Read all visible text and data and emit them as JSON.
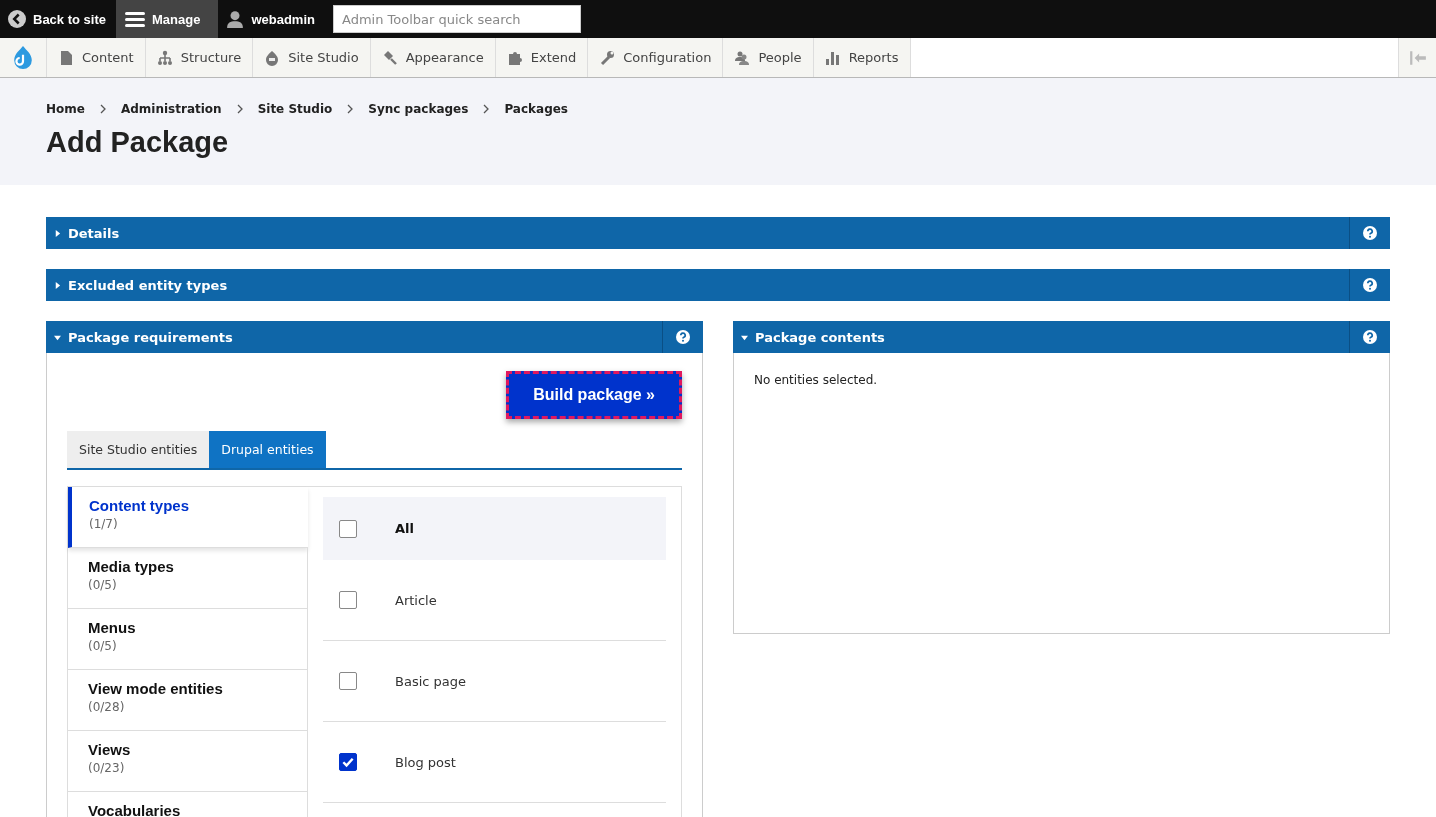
{
  "admin_bar": {
    "back": "Back to site",
    "manage": {
      "label": "Manage",
      "selected": true
    },
    "user": "webadmin",
    "search": {
      "placeholder": "Admin Toolbar quick search"
    }
  },
  "menu": [
    {
      "label": "Content"
    },
    {
      "label": "Structure"
    },
    {
      "label": "Site Studio"
    },
    {
      "label": "Appearance"
    },
    {
      "label": "Extend"
    },
    {
      "label": "Configuration"
    },
    {
      "label": "People"
    },
    {
      "label": "Reports"
    }
  ],
  "breadcrumb": [
    "Home",
    "Administration",
    "Site Studio",
    "Sync packages",
    "Packages"
  ],
  "title": "Add Package",
  "sections": [
    {
      "title": "Details",
      "expanded": false
    },
    {
      "title": "Excluded entity types",
      "expanded": false
    }
  ],
  "requirements": {
    "title": "Package requirements",
    "expanded": true,
    "build_button": "Build package »",
    "tabs": [
      {
        "label": "Site Studio entities",
        "selected": false
      },
      {
        "label": "Drupal entities",
        "selected": true
      }
    ],
    "categories": [
      {
        "label": "Content types",
        "count": "(1/7)",
        "selected": true
      },
      {
        "label": "Media types",
        "count": "(0/5)",
        "selected": false
      },
      {
        "label": "Menus",
        "count": "(0/5)",
        "selected": false
      },
      {
        "label": "View mode entities",
        "count": "(0/28)",
        "selected": false
      },
      {
        "label": "Views",
        "count": "(0/23)",
        "selected": false
      },
      {
        "label": "Vocabularies",
        "selected": false
      }
    ],
    "options": [
      {
        "kind": "all",
        "label": "All",
        "checked": false
      },
      {
        "kind": "item",
        "label": "Article",
        "checked": false
      },
      {
        "kind": "item",
        "label": "Basic page",
        "checked": false
      },
      {
        "kind": "item",
        "label": "Blog post",
        "checked": true
      }
    ]
  },
  "contents": {
    "title": "Package contents",
    "expanded": true,
    "message": "No entities selected."
  }
}
